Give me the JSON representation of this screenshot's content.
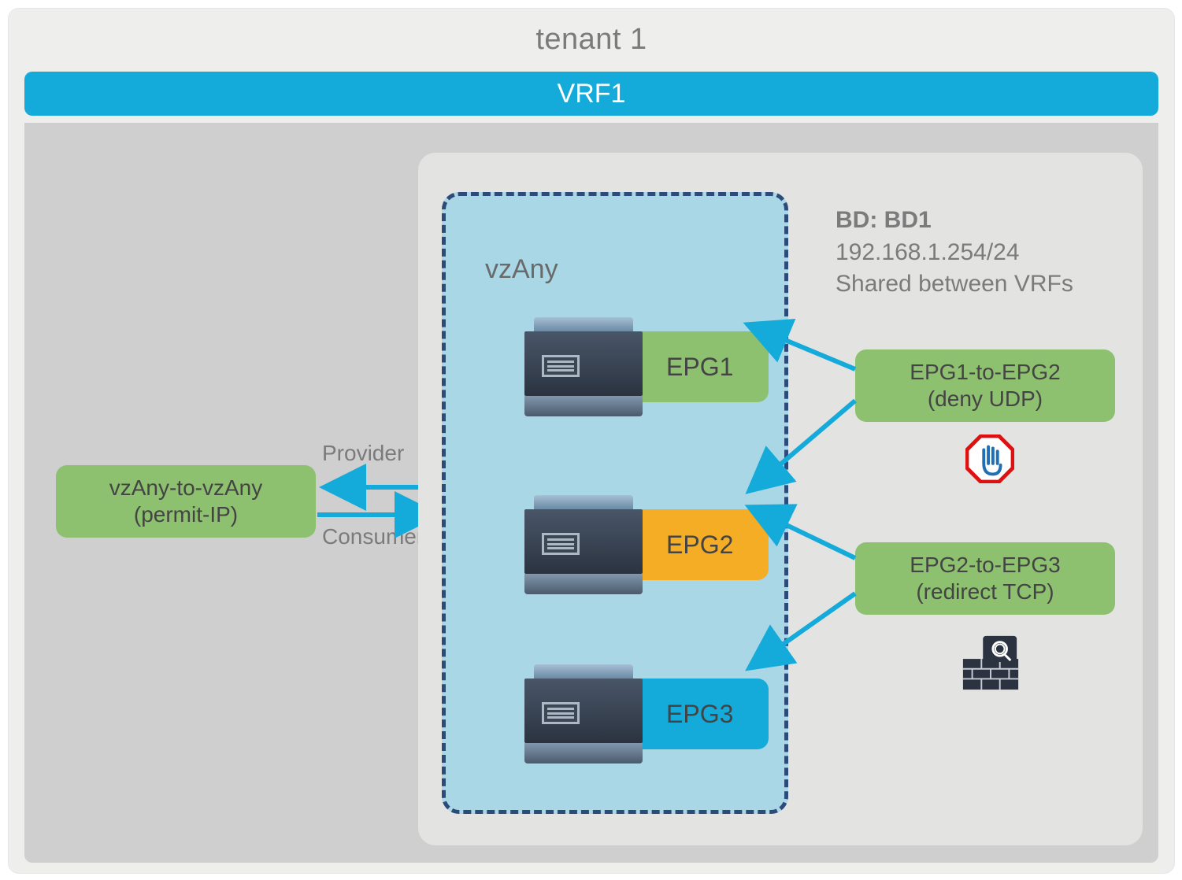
{
  "tenant": {
    "label": "tenant 1"
  },
  "vrf": {
    "label": "VRF1"
  },
  "vzany": {
    "label": "vzAny"
  },
  "bd": {
    "title": "BD: BD1",
    "subnet": "192.168.1.254/24",
    "note": "Shared between VRFs"
  },
  "epgs": {
    "epg1": {
      "label": "EPG1",
      "color": "green"
    },
    "epg2": {
      "label": "EPG2",
      "color": "orange"
    },
    "epg3": {
      "label": "EPG3",
      "color": "blue"
    }
  },
  "contracts": {
    "left": {
      "line1": "vzAny-to-vzAny",
      "line2": "(permit-IP)"
    },
    "c1": {
      "line1": "EPG1-to-EPG2",
      "line2": "(deny UDP)"
    },
    "c2": {
      "line1": "EPG2-to-EPG3",
      "line2": "(redirect TCP)"
    }
  },
  "roles": {
    "provider": "Provider",
    "consumer": "Consumer"
  },
  "icons": {
    "stop": "stop-hand",
    "firewall": "firewall"
  },
  "arrowColor": "#14abdb"
}
